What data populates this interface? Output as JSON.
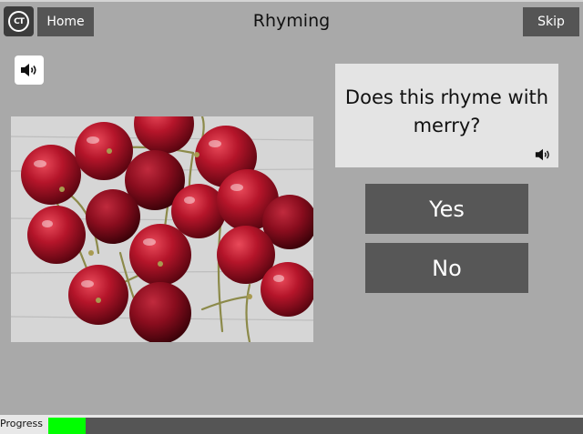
{
  "header": {
    "logo_text": "CT",
    "home_label": "Home",
    "title": "Rhyming",
    "skip_label": "Skip"
  },
  "question": {
    "text": "Does this rhyme with merry?"
  },
  "answers": {
    "yes_label": "Yes",
    "no_label": "No"
  },
  "progress": {
    "label": "Progress",
    "fraction": 0.07,
    "fill_color": "#00ff00"
  },
  "icons": {
    "sound": "speaker-icon",
    "image": "cherries-photo"
  }
}
